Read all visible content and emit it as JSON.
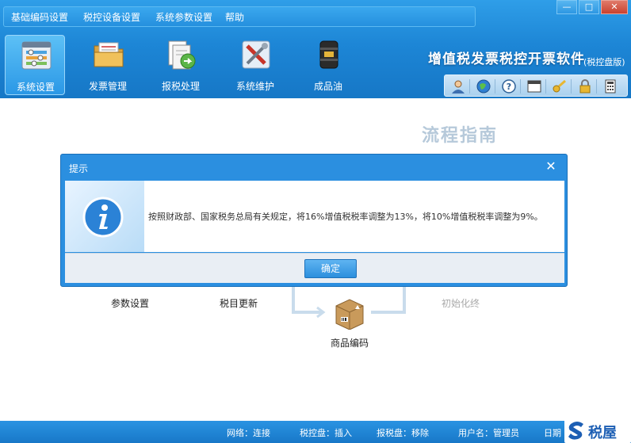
{
  "menu": [
    "基础编码设置",
    "税控设备设置",
    "系统参数设置",
    "帮助"
  ],
  "window_controls": {
    "minimize": "—",
    "maximize": "□",
    "close": "✕"
  },
  "toolbar": [
    {
      "label": "系统设置",
      "icon": "settings-panel-icon",
      "active": true
    },
    {
      "label": "发票管理",
      "icon": "folder-invoice-icon",
      "active": false
    },
    {
      "label": "报税处理",
      "icon": "tax-report-icon",
      "active": false
    },
    {
      "label": "系统维护",
      "icon": "tools-icon",
      "active": false
    },
    {
      "label": "成品油",
      "icon": "oil-barrel-icon",
      "active": false
    }
  ],
  "app": {
    "title": "增值税发票税控开票软件",
    "subtitle": "(税控盘版)"
  },
  "small_toolbar": [
    "user-icon",
    "globe-icon",
    "help-icon",
    "window-icon",
    "key-icon",
    "lock-icon",
    "calculator-icon"
  ],
  "guide": {
    "title": "流程指南",
    "steps": [
      {
        "label": "参数设置",
        "muted": false
      },
      {
        "label": "税目更新",
        "muted": false
      },
      {
        "label": "商品编码",
        "muted": false
      },
      {
        "label": "初始化终",
        "muted": true
      }
    ]
  },
  "dialog": {
    "title": "提示",
    "close": "✕",
    "message": "按照财政部、国家税务总局有关规定，将16%增值税税率调整为13%，将10%增值税税率调整为9%。",
    "ok_label": "确定"
  },
  "status": {
    "network": "网络：连接",
    "tax_disk": "税控盘：插入",
    "report_disk": "报税盘：移除",
    "user": "用户名：管理员",
    "date": "日期"
  },
  "watermark": {
    "text": "税屋"
  },
  "colors": {
    "header": "#1d86d6",
    "dialog_title": "#2b8fe0",
    "ok_button": "#2c8fdd",
    "guide_title": "#b6c9da"
  }
}
